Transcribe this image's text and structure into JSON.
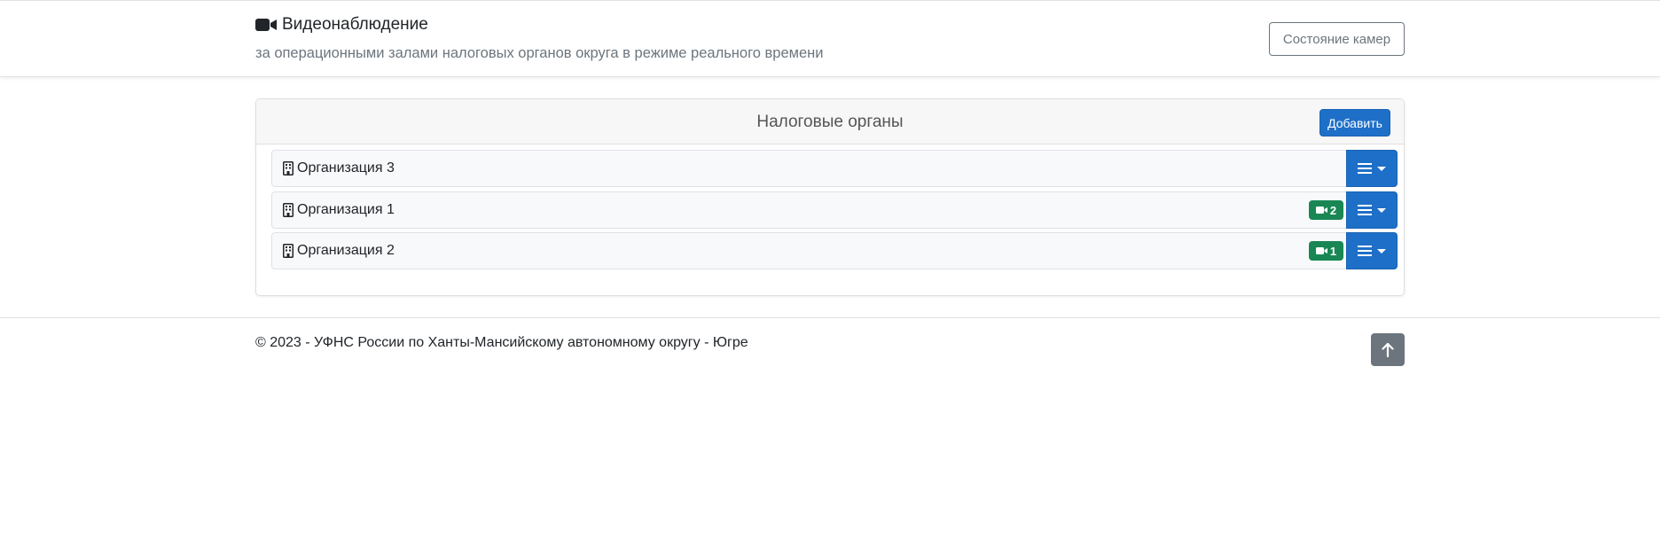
{
  "header": {
    "title": "Видеонаблюдение",
    "subtitle": "за операционными залами налоговых органов округа в режиме реального времени",
    "title_icon": "video-camera-icon",
    "camera_status_button": "Состояние камер"
  },
  "card": {
    "title": "Налоговые органы",
    "add_button": "Добавить"
  },
  "organizations": [
    {
      "name": "Организация 3",
      "icon": "building-icon",
      "camera_count": null
    },
    {
      "name": "Организация 1",
      "icon": "building-icon",
      "camera_count": "2"
    },
    {
      "name": "Организация 2",
      "icon": "building-icon",
      "camera_count": "1"
    }
  ],
  "footer": {
    "copyright": "© 2023 - УФНС России по Ханты-Мансийскому автономному округу - Югре",
    "scroll_top_icon": "arrow-up-icon"
  },
  "colors": {
    "primary": "#1e6fc8",
    "success": "#198754",
    "secondary": "#6c757d"
  }
}
